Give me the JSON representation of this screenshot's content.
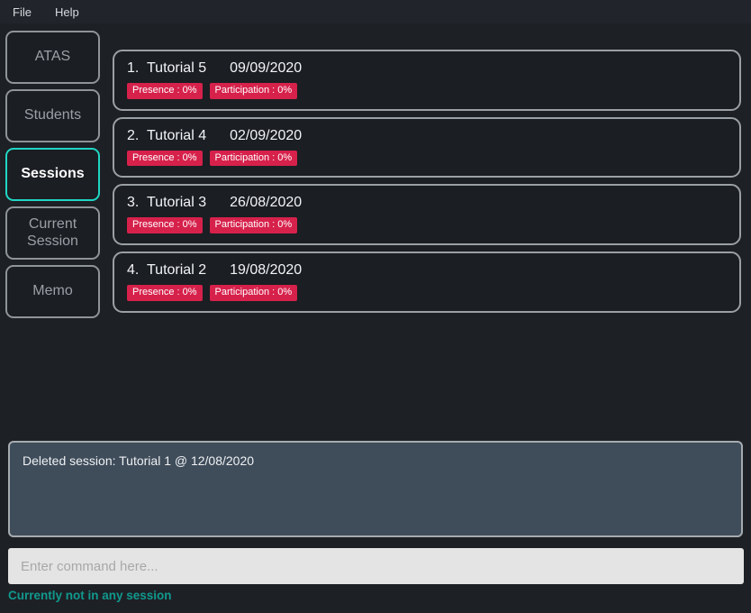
{
  "menu": {
    "items": [
      {
        "label": "File"
      },
      {
        "label": "Help"
      }
    ]
  },
  "sidebar": {
    "items": [
      {
        "label": "ATAS",
        "selected": false
      },
      {
        "label": "Students",
        "selected": false
      },
      {
        "label": "Sessions",
        "selected": true
      },
      {
        "label": "Current Session",
        "selected": false
      },
      {
        "label": "Memo",
        "selected": false
      }
    ]
  },
  "sessions": [
    {
      "index": "1.",
      "name": "Tutorial 5",
      "date": "09/09/2020",
      "presence": "Presence : 0%",
      "participation": "Participation : 0%"
    },
    {
      "index": "2.",
      "name": "Tutorial 4",
      "date": "02/09/2020",
      "presence": "Presence : 0%",
      "participation": "Participation : 0%"
    },
    {
      "index": "3.",
      "name": "Tutorial 3",
      "date": "26/08/2020",
      "presence": "Presence : 0%",
      "participation": "Participation : 0%"
    },
    {
      "index": "4.",
      "name": "Tutorial 2",
      "date": "19/08/2020",
      "presence": "Presence : 0%",
      "participation": "Participation : 0%"
    }
  ],
  "result": {
    "message": "Deleted session: Tutorial 1 @ 12/08/2020"
  },
  "command": {
    "value": "",
    "placeholder": "Enter command here..."
  },
  "status": {
    "text": "Currently not in any session"
  },
  "colors": {
    "background": "#1d2025",
    "menu_bar": "#21252b",
    "accent_selected": "#20d6c4",
    "badge": "#d6214b",
    "result_panel": "#3f4c5a",
    "status_text": "#11998e",
    "border": "#9aa0a5",
    "command_field": "#e4e4e4"
  }
}
